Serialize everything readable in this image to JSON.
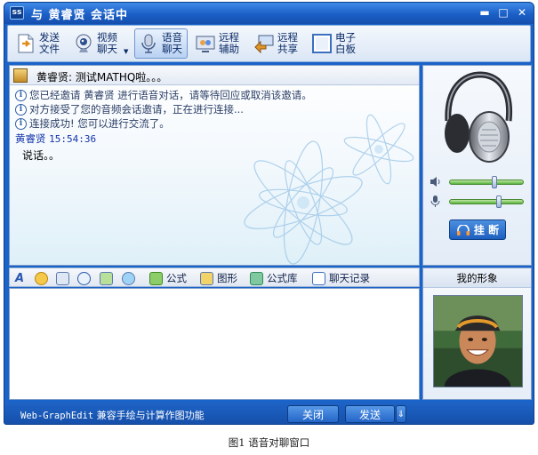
{
  "window": {
    "title": "与 黄睿贤 会话中",
    "logo_text": "ss",
    "controls": {
      "minimize": "▬",
      "maximize": "□",
      "close": "✕"
    }
  },
  "toolbar": {
    "items": [
      {
        "label": "发送文件",
        "icon": "send-file-icon"
      },
      {
        "label": "视频聊天",
        "icon": "webcam-icon",
        "has_dropdown": true
      },
      {
        "label": "语音聊天",
        "icon": "microphone-icon",
        "active": true
      },
      {
        "label": "远程辅助",
        "icon": "remote-assist-icon"
      },
      {
        "label": "远程共享",
        "icon": "remote-share-icon"
      },
      {
        "label": "电子白板",
        "icon": "whiteboard-icon"
      }
    ]
  },
  "chat": {
    "contact_name": "黄睿贤",
    "contact_status": ": 测试MATHQ啦。。。",
    "system_messages": [
      "您已经邀请 黄睿贤 进行语音对话，请等待回应或取消该邀请。",
      "对方接受了您的音频会话邀请，正在进行连接...",
      "连接成功! 您可以进行交流了。"
    ],
    "message": {
      "sender": "黄睿贤",
      "time": "15:54:36",
      "text": "说话。。"
    }
  },
  "input_toolbar": {
    "formula_label": "公式",
    "shape_label": "图形",
    "formula_lib_label": "公式库",
    "history_label": "聊天记录"
  },
  "voice_panel": {
    "speaker_volume": 0.6,
    "mic_volume": 0.67,
    "hangup_label": "挂 断"
  },
  "avatar_panel": {
    "title": "我的形象"
  },
  "status_bar": {
    "app_name": "Web-GraphEdit",
    "description": " 兼容手绘与计算作图功能",
    "close_label": "关闭",
    "send_label": "发送",
    "send_arrow": "⇓"
  },
  "caption": "图1   语音对聊窗口",
  "colors": {
    "window_blue": "#1a63c8",
    "status_blue": "#154ea8",
    "volume_green": "#56b23a"
  }
}
